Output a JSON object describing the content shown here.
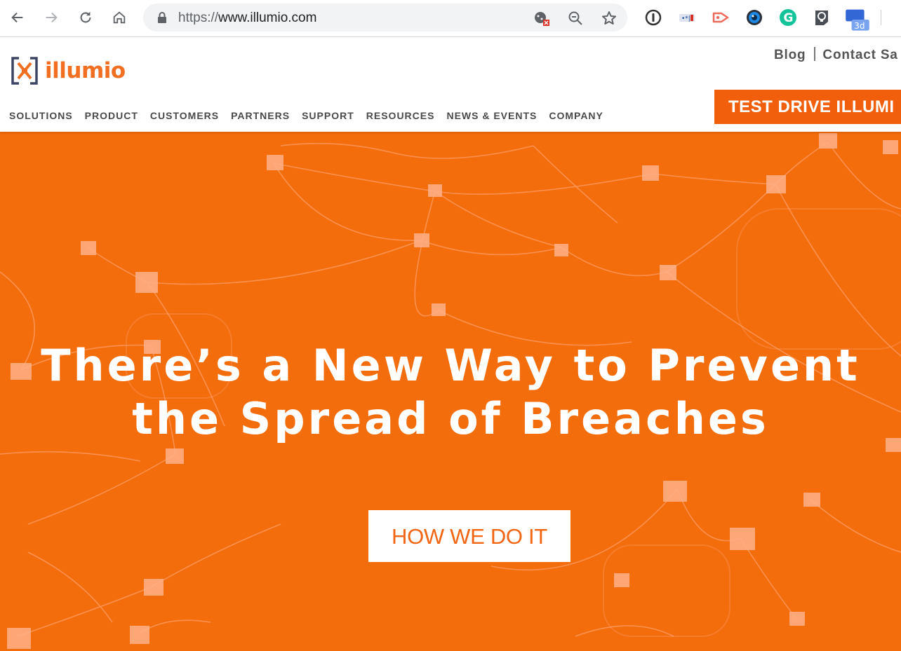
{
  "browser": {
    "url_scheme": "https://",
    "url_host": "www.illumio.com",
    "extension_badge": "3d",
    "icons": [
      "back-arrow-icon",
      "forward-arrow-icon",
      "reload-icon",
      "home-icon",
      "lock-icon",
      "cookie-blocked-icon",
      "zoom-out-icon",
      "star-icon",
      "password-manager-icon",
      "extension-icon",
      "cast-icon",
      "eye-icon",
      "grammarly-icon",
      "lightbulb-icon",
      "tabs-icon"
    ]
  },
  "site": {
    "logo_text": "illumio",
    "utility_links": [
      "Blog",
      "Contact Sa"
    ],
    "nav": [
      "SOLUTIONS",
      "PRODUCT",
      "CUSTOMERS",
      "PARTNERS",
      "SUPPORT",
      "RESOURCES",
      "NEWS & EVENTS",
      "COMPANY"
    ],
    "cta_label": "TEST DRIVE ILLUMI",
    "brand_color": "#f15f0d"
  },
  "hero": {
    "headline_line1": "There’s a New Way to Prevent",
    "headline_line2": "the Spread of Breaches",
    "button_label": "HOW WE DO IT",
    "background_color": "#f46d0c"
  }
}
